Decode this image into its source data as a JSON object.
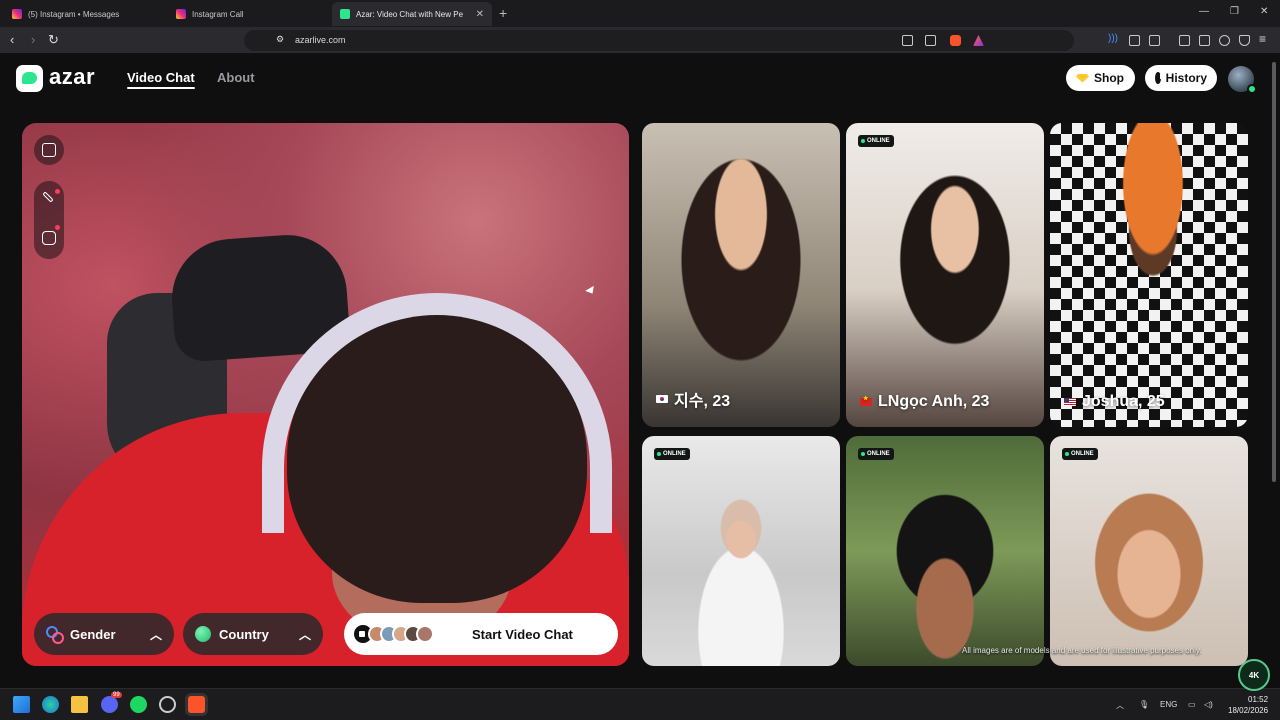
{
  "browser": {
    "tabs": [
      {
        "label": "(5) Instagram • Messages",
        "favicon": "instagram-icon"
      },
      {
        "label": "Instagram Call",
        "favicon": "instagram-icon"
      },
      {
        "label": "Azar: Video Chat with New Pe",
        "favicon": "azar-icon",
        "active": true
      }
    ],
    "url": "azarlive.com"
  },
  "site": {
    "logo": "azar",
    "nav": {
      "video_chat": "Video Chat",
      "about": "About"
    },
    "shop_label": "Shop",
    "history_label": "History"
  },
  "controls": {
    "gender_label": "Gender",
    "country_label": "Country",
    "start_label": "Start Video Chat"
  },
  "profiles": [
    {
      "name": "지수, 23",
      "flag": "kr",
      "online": false
    },
    {
      "name": "LNgọc Anh, 23",
      "flag": "vn",
      "online": true
    },
    {
      "name": "Joshua, 25",
      "flag": "us",
      "online": false
    },
    {
      "name": "",
      "online": true
    },
    {
      "name": "",
      "online": true
    },
    {
      "name": "",
      "online": true
    }
  ],
  "online_badge": "ONLINE",
  "disclaimer": "All images are of models and are used for illustrative purposes only.",
  "taskbar": {
    "lang": "ENG",
    "time": "01:52",
    "date": "18/02/2026",
    "discord_badge": "99"
  },
  "watermark": "4K",
  "colors": {
    "accent": "#2ee58f",
    "background": "#0f0f10"
  }
}
